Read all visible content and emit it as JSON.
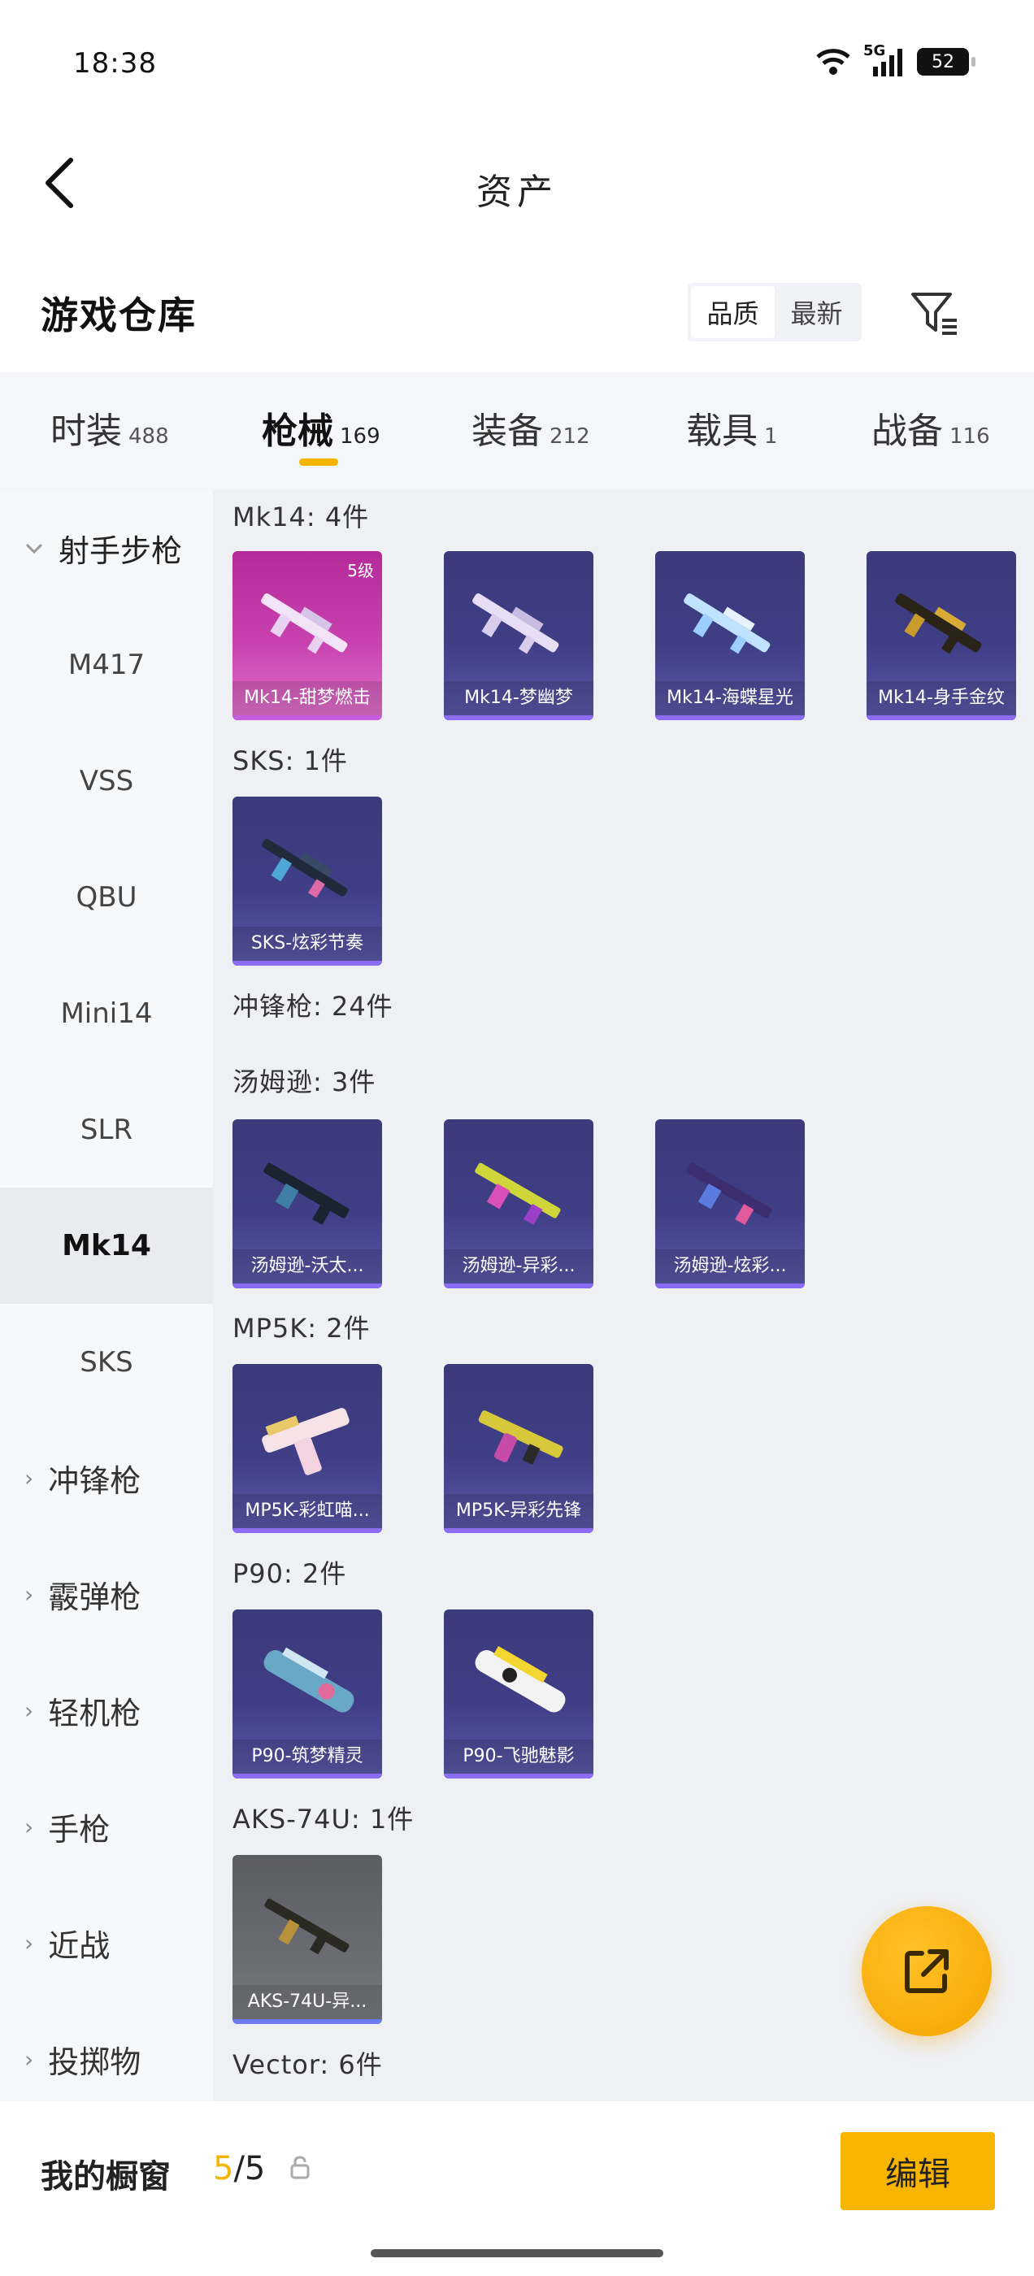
{
  "status_bar": {
    "time": "18:38",
    "network": "5G",
    "battery": "52"
  },
  "nav": {
    "title": "资产"
  },
  "warehouse": {
    "title": "游戏仓库",
    "sort_options": [
      "品质",
      "最新"
    ]
  },
  "tabs": [
    {
      "label": "时装",
      "count": "488"
    },
    {
      "label": "枪械",
      "count": "169"
    },
    {
      "label": "装备",
      "count": "212"
    },
    {
      "label": "载具",
      "count": "1"
    },
    {
      "label": "战备",
      "count": "116"
    }
  ],
  "sidebar": {
    "category": "射手步枪",
    "subitems": [
      "M417",
      "VSS",
      "QBU",
      "Mini14",
      "SLR",
      "Mk14",
      "SKS"
    ],
    "active": "Mk14",
    "categories": [
      "冲锋枪",
      "霰弹枪",
      "轻机枪",
      "手枪",
      "近战",
      "投掷物"
    ]
  },
  "sections": [
    {
      "title": "Mk14: 4件",
      "items": [
        "Mk14-甜梦燃击",
        "Mk14-梦幽梦",
        "Mk14-海蝶星光",
        "Mk14-身手金纹"
      ]
    },
    {
      "title": "SKS: 1件",
      "items": [
        "SKS-炫彩节奏"
      ]
    },
    {
      "title": "冲锋枪: 24件",
      "items": []
    },
    {
      "title": "汤姆逊: 3件",
      "items": [
        "汤姆逊-沃太...",
        "汤姆逊-异彩...",
        "汤姆逊-炫彩..."
      ]
    },
    {
      "title": "MP5K: 2件",
      "items": [
        "MP5K-彩虹喵...",
        "MP5K-异彩先锋"
      ]
    },
    {
      "title": "P90: 2件",
      "items": [
        "P90-筑梦精灵",
        "P90-飞驰魅影"
      ]
    },
    {
      "title": "AKS-74U: 1件",
      "items": [
        "AKS-74U-异..."
      ]
    },
    {
      "title": "Vector: 6件",
      "items": []
    }
  ],
  "card_badge": "5级",
  "bottom": {
    "showcase_label": "我的橱窗",
    "count_current": "5",
    "count_sep": "/5",
    "edit_label": "编辑"
  }
}
